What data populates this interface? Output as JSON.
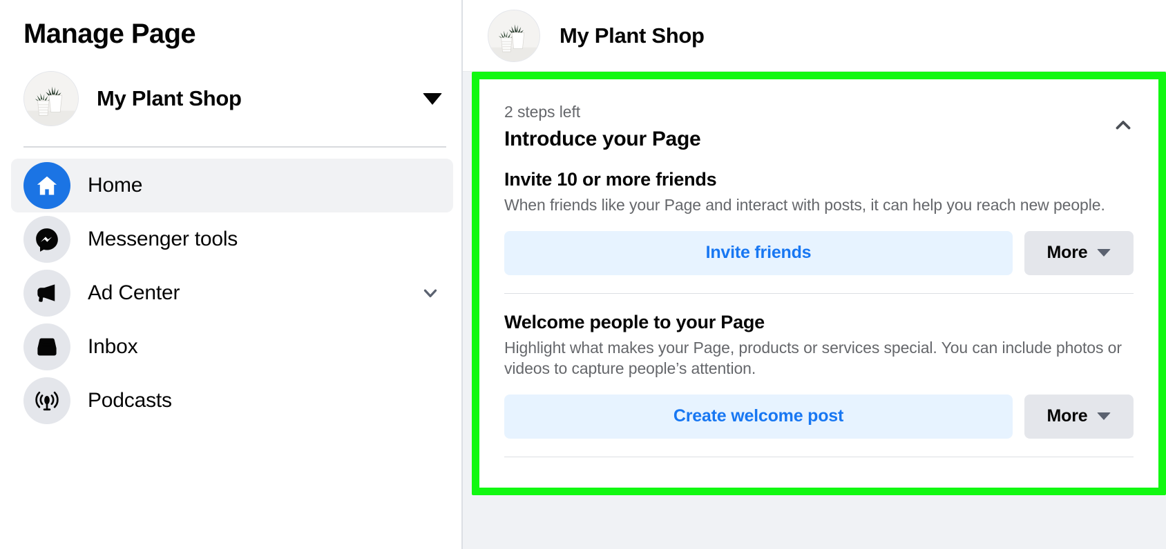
{
  "sidebar": {
    "title": "Manage Page",
    "page": {
      "name": "My Plant Shop",
      "avatar_icon": "plant-pots-photo",
      "caret_icon": "caret-down-icon"
    },
    "items": [
      {
        "label": "Home",
        "icon": "home-icon",
        "active": true,
        "has_chevron": false
      },
      {
        "label": "Messenger tools",
        "icon": "messenger-icon",
        "active": false,
        "has_chevron": false
      },
      {
        "label": "Ad Center",
        "icon": "megaphone-icon",
        "active": false,
        "has_chevron": true
      },
      {
        "label": "Inbox",
        "icon": "inbox-icon",
        "active": false,
        "has_chevron": false
      },
      {
        "label": "Podcasts",
        "icon": "podcast-icon",
        "active": false,
        "has_chevron": false
      }
    ]
  },
  "main": {
    "header": {
      "page_name": "My Plant Shop",
      "avatar_icon": "plant-pots-photo"
    },
    "card": {
      "steps_left": "2 steps left",
      "title": "Introduce your Page",
      "collapse_icon": "chevron-up-icon",
      "tasks": [
        {
          "title": "Invite 10 or more friends",
          "description": "When friends like your Page and interact with posts, it can help you reach new people.",
          "primary_label": "Invite friends",
          "more_label": "More",
          "more_caret_icon": "caret-down-icon"
        },
        {
          "title": "Welcome people to your Page",
          "description": "Highlight what makes your Page, products or services special. You can include photos or videos to capture people’s attention.",
          "primary_label": "Create welcome post",
          "more_label": "More",
          "more_caret_icon": "caret-down-icon"
        }
      ]
    }
  },
  "colors": {
    "highlight": "#11f811",
    "accent_blue": "#1877f2",
    "primary_btn_bg": "#e7f3ff",
    "secondary_btn_bg": "#e4e6eb",
    "active_nav_bg": "#f1f2f4",
    "muted_text": "#65676b",
    "main_bg": "#f0f2f5"
  }
}
